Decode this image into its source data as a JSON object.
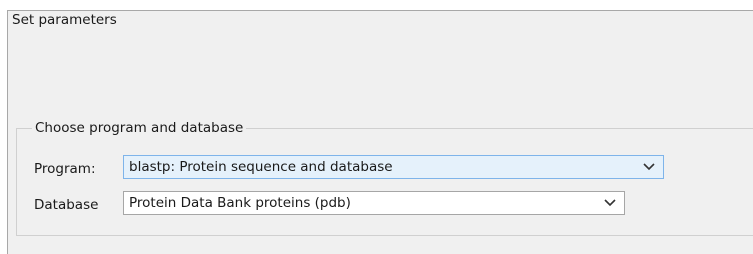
{
  "window": {
    "title": "Set parameters"
  },
  "group": {
    "legend": "Choose program and database"
  },
  "program": {
    "label": "Program:",
    "selected": "blastp: Protein sequence and database"
  },
  "database": {
    "label": "Database",
    "selected": "Protein Data Bank proteins (pdb)"
  },
  "icons": {
    "dropdown": "chevron-down-icon"
  },
  "colors": {
    "panel_bg": "#f0f0f0",
    "focused_select_bg": "#e5f1fb",
    "focused_select_border": "#7eb4ea"
  }
}
